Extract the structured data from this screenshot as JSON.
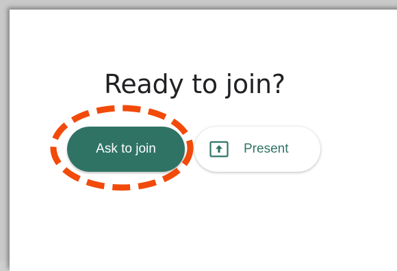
{
  "dialog": {
    "title": "Ready to join?"
  },
  "buttons": {
    "ask_to_join_label": "Ask to join",
    "present_label": "Present"
  },
  "icons": {
    "present": "present-screen-icon"
  },
  "colors": {
    "primary": "#2f7365",
    "highlight": "#f24a0a"
  }
}
